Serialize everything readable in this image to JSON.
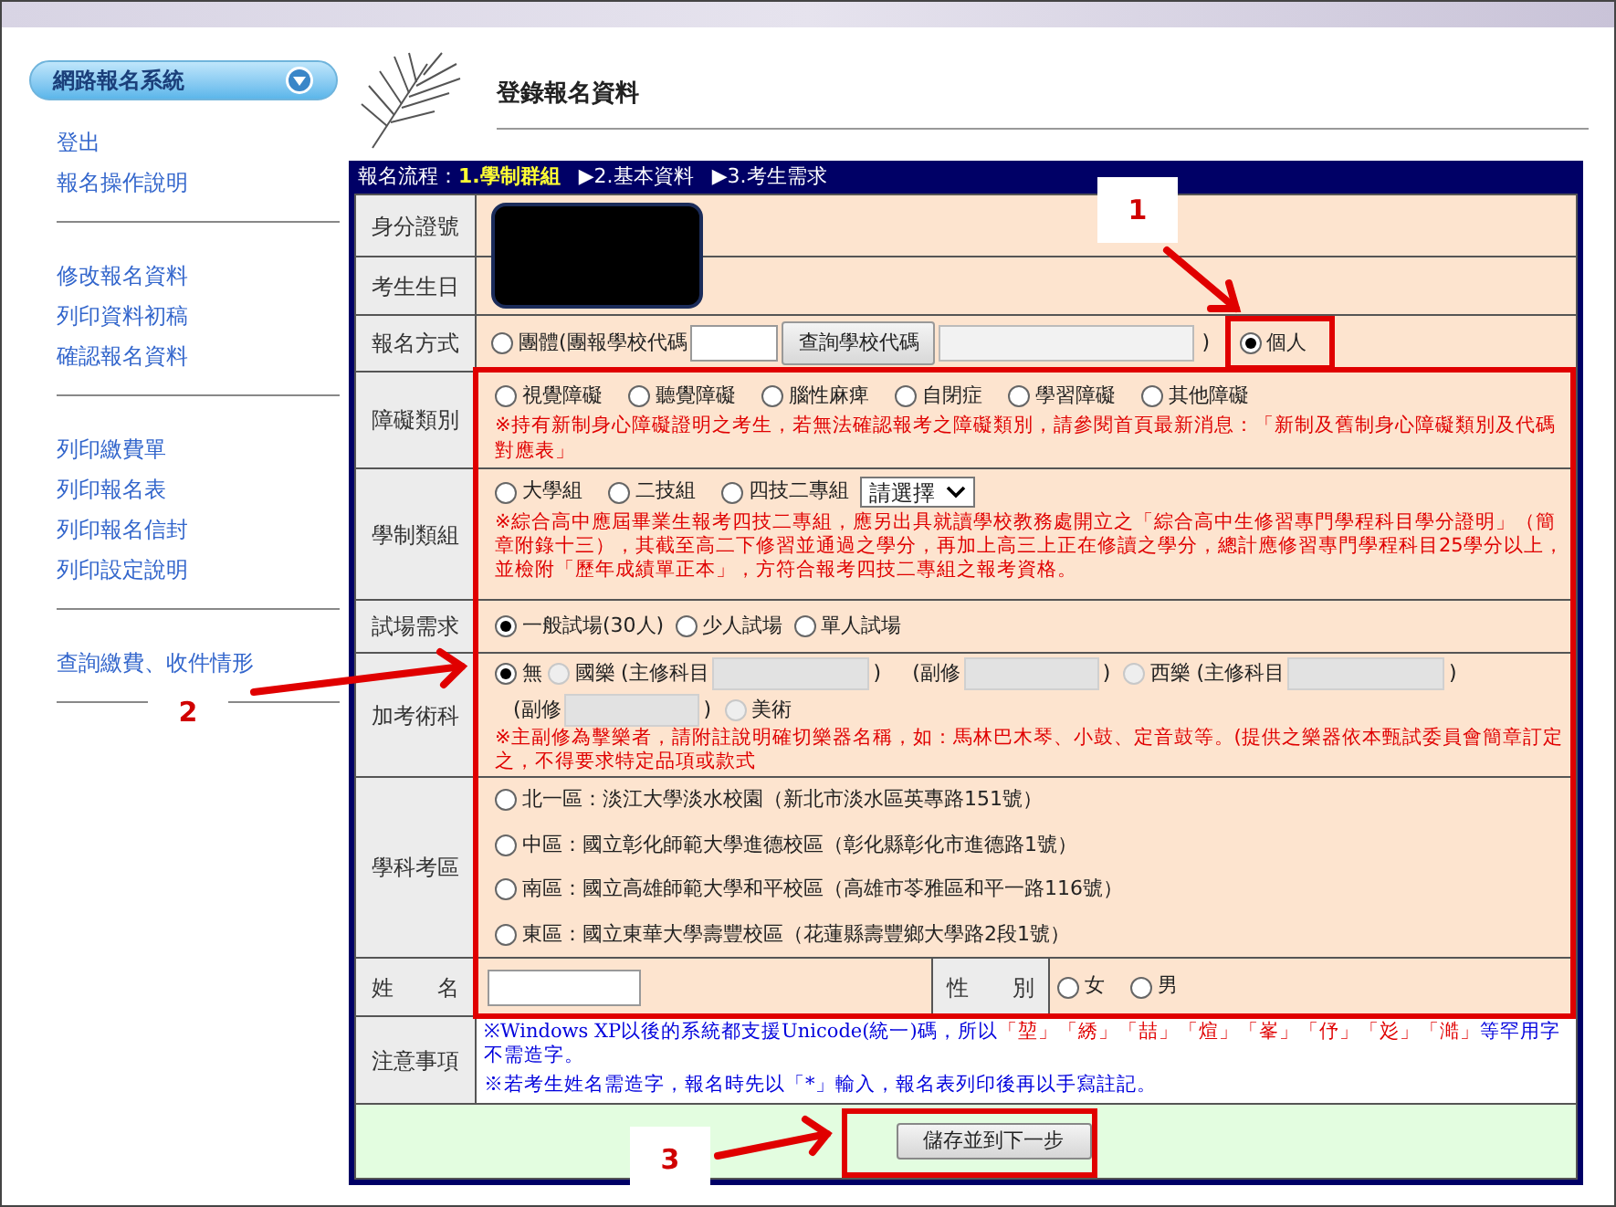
{
  "sidebar": {
    "menu_title": "網路報名系統",
    "groups": [
      [
        "登出",
        "報名操作說明"
      ],
      [
        "修改報名資料",
        "列印資料初稿",
        "確認報名資料"
      ],
      [
        "列印繳費單",
        "列印報名表",
        "列印報名信封",
        "列印設定說明"
      ],
      [
        "查詢繳費、收件情形"
      ]
    ]
  },
  "page_title": "登錄報名資料",
  "steps": {
    "prefix": "報名流程：",
    "items": [
      {
        "label": "1.學制群組",
        "selected": true
      },
      {
        "label": "▶2.基本資料",
        "selected": false
      },
      {
        "label": "▶3.考生需求",
        "selected": false
      }
    ]
  },
  "id_row": {
    "label": "身分證號"
  },
  "birth_row": {
    "label": "考生生日"
  },
  "signup_method": {
    "label": "報名方式",
    "group_option": {
      "label": "團體(團報學校代碼",
      "selected": false
    },
    "lookup_button": "查詢學校代碼",
    "close_paren": ")",
    "individual_option": {
      "label": "個人",
      "selected": true
    }
  },
  "disability": {
    "label": "障礙類別",
    "options": [
      {
        "label": "視覺障礙",
        "selected": false
      },
      {
        "label": "聽覺障礙",
        "selected": false
      },
      {
        "label": "腦性麻痺",
        "selected": false
      },
      {
        "label": "自閉症",
        "selected": false
      },
      {
        "label": "學習障礙",
        "selected": false
      },
      {
        "label": "其他障礙",
        "selected": false
      }
    ],
    "note": "※持有新制身心障礙證明之考生，若無法確認報考之障礙類別，請參閱首頁最新消息：「新制及舊制身心障礙類別及代碼對應表」"
  },
  "school_group": {
    "label": "學制類組",
    "options": [
      {
        "label": "大學組",
        "selected": false
      },
      {
        "label": "二技組",
        "selected": false
      },
      {
        "label": "四技二專組",
        "selected": false
      }
    ],
    "select": "請選擇",
    "note": "※綜合高中應屆畢業生報考四技二專組，應另出具就讀學校教務處開立之「綜合高中生修習專門學程科目學分證明」（簡章附錄十三），其截至高二下修習並通過之學分，再加上高三上正在修讀之學分，總計應修習專門學程科目25學分以上，並檢附「歷年成績單正本」，方符合報考四技二專組之報考資格。"
  },
  "exam_room": {
    "label": "試場需求",
    "options": [
      {
        "label": "一般試場(30人)",
        "selected": true
      },
      {
        "label": "少人試場",
        "selected": false
      },
      {
        "label": "單人試場",
        "selected": false
      }
    ]
  },
  "arts": {
    "label": "加考術科",
    "options": [
      {
        "label": "無",
        "selected": true,
        "disabled": false
      },
      {
        "label": "國樂",
        "selected": false,
        "disabled": true,
        "fields": [
          {
            "prefix": "(主修科目",
            "suffix": ")"
          },
          {
            "prefix": "(副修",
            "suffix": ")"
          }
        ]
      },
      {
        "label": "西樂",
        "selected": false,
        "disabled": true,
        "fields": [
          {
            "prefix": "(主修科目",
            "suffix": ")"
          },
          {
            "prefix": "(副修",
            "suffix": ")"
          }
        ]
      },
      {
        "label": "美術",
        "selected": false,
        "disabled": true
      }
    ],
    "note": "※主副修為擊樂者，請附註說明確切樂器名稱，如：馬林巴木琴、小鼓、定音鼓等。(提供之樂器依本甄試委員會簡章訂定之，不得要求特定品項或款式"
  },
  "exam_area": {
    "label": "學科考區",
    "options": [
      {
        "label": "北一區：淡江大學淡水校園（新北市淡水區英專路151號）",
        "selected": false
      },
      {
        "label": "中區：國立彰化師範大學進德校區（彰化縣彰化市進德路1號）",
        "selected": false
      },
      {
        "label": "南區：國立高雄師範大學和平校區（高雄市苓雅區和平一路116號）",
        "selected": false
      },
      {
        "label": "東區：國立東華大學壽豐校區（花蓮縣壽豐鄉大學路2段1號）",
        "selected": false
      }
    ]
  },
  "name_row": {
    "label": "姓　　名",
    "gender_label": "性　　別",
    "gender_options": [
      {
        "label": "女",
        "selected": false
      },
      {
        "label": "男",
        "selected": false
      }
    ]
  },
  "notice": {
    "label": "注意事項",
    "lines": [
      [
        {
          "text": "※Windows XP以後的系統都支援Unicode(統一)碼，所以",
          "emphasis": false
        },
        {
          "text": "「堃」「綉」「喆」「煊」「峯」「伃」「彣」「澔」",
          "emphasis": true
        },
        {
          "text": "等罕用字不需造字。",
          "emphasis": false
        }
      ],
      [
        {
          "text": "※若考生姓名需造字，報名時先以「*」輸入，報名表列印後再以手寫註記。",
          "emphasis": false
        }
      ]
    ]
  },
  "submit_button": "儲存並到下一步",
  "annotations": [
    {
      "label": "1"
    },
    {
      "label": "2"
    },
    {
      "label": "3"
    }
  ]
}
